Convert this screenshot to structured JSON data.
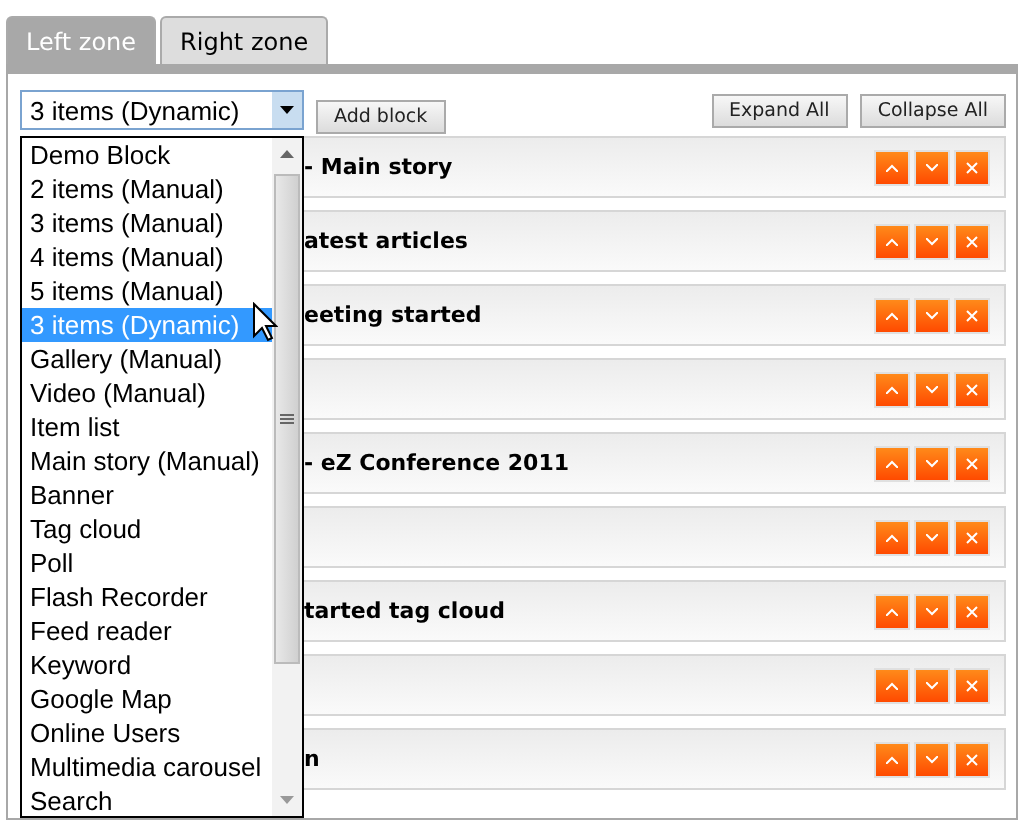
{
  "tabs": [
    {
      "label": "Left zone",
      "selected": true
    },
    {
      "label": "Right zone",
      "selected": false
    }
  ],
  "block_type_select": {
    "value": "3 items (Dynamic)",
    "options": [
      {
        "label": "Demo Block",
        "selected": false
      },
      {
        "label": "2 items (Manual)",
        "selected": false
      },
      {
        "label": "3 items (Manual)",
        "selected": false
      },
      {
        "label": "4 items (Manual)",
        "selected": false
      },
      {
        "label": "5 items (Manual)",
        "selected": false
      },
      {
        "label": "3 items (Dynamic)",
        "selected": true
      },
      {
        "label": "Gallery (Manual)",
        "selected": false
      },
      {
        "label": "Video (Manual)",
        "selected": false
      },
      {
        "label": "Item list",
        "selected": false
      },
      {
        "label": "Main story (Manual)",
        "selected": false
      },
      {
        "label": "Banner",
        "selected": false
      },
      {
        "label": "Tag cloud",
        "selected": false
      },
      {
        "label": "Poll",
        "selected": false
      },
      {
        "label": "Flash Recorder",
        "selected": false
      },
      {
        "label": "Feed reader",
        "selected": false
      },
      {
        "label": "Keyword",
        "selected": false
      },
      {
        "label": "Google Map",
        "selected": false
      },
      {
        "label": "Online Users",
        "selected": false
      },
      {
        "label": "Multimedia carousel",
        "selected": false
      },
      {
        "label": "Search",
        "selected": false
      }
    ]
  },
  "add_block_button": "Add block",
  "expand_all_button": "Expand All",
  "collapse_all_button": "Collapse All",
  "blocks": [
    {
      "kind": "titled",
      "title": "- Main story"
    },
    {
      "kind": "titled",
      "title": "atest articles"
    },
    {
      "kind": "titled",
      "title": "eeting started"
    },
    {
      "kind": "untitled"
    },
    {
      "kind": "titled",
      "title": "- eZ Conference 2011"
    },
    {
      "kind": "untitled"
    },
    {
      "kind": "titled",
      "title": "tarted tag cloud"
    },
    {
      "kind": "untitled"
    },
    {
      "kind": "titled",
      "title": "n"
    }
  ]
}
